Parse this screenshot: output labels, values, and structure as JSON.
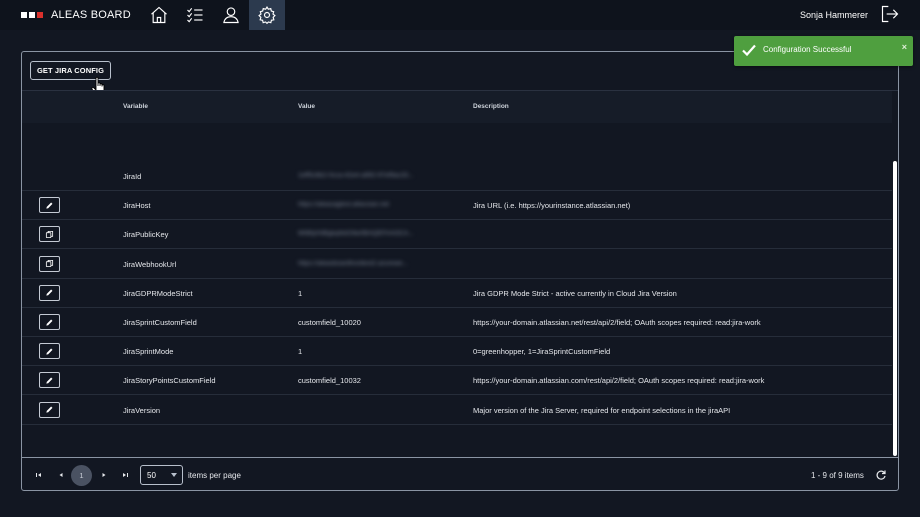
{
  "app": {
    "brand": "ALEAS BOARD",
    "logo_colors": [
      "#ffffff",
      "#ffffff",
      "#d9302c"
    ],
    "nav": [
      {
        "icon": "home-icon"
      },
      {
        "icon": "checklist-icon"
      },
      {
        "icon": "user-icon"
      },
      {
        "icon": "gear-icon",
        "active": true
      }
    ],
    "user_name": "Sonja Hammerer"
  },
  "toolbar": {
    "get_config_label": "GET JIRA CONFIG"
  },
  "table": {
    "headers": {
      "variable": "Variable",
      "value": "Value",
      "description": "Description"
    },
    "rows": [
      {
        "action": "",
        "variable": "JiraId",
        "value": "1eff5c6b2-0cca-42e4-a992-97ef9ac33...",
        "value_redacted": true,
        "description": ""
      },
      {
        "action": "edit",
        "variable": "JiraHost",
        "value": "https://aleasagtest.atlassian.net",
        "value_redacted": true,
        "description": "Jira URL (i.e. https://yourinstance.atlassian.net)"
      },
      {
        "action": "copy",
        "variable": "JiraPublicKey",
        "value": "MIIBIjANBgkqhkiG9w0BAQEFAAOCA...",
        "value_redacted": true,
        "description": ""
      },
      {
        "action": "copy",
        "variable": "JiraWebhookUrl",
        "value": "https://aleasboardhosttest2.azurewe...",
        "value_redacted": true,
        "description": ""
      },
      {
        "action": "edit",
        "variable": "JiraGDPRModeStrict",
        "value": "1",
        "value_redacted": false,
        "description": "Jira GDPR Mode Strict - active currently in Cloud Jira Version"
      },
      {
        "action": "edit",
        "variable": "JiraSprintCustomField",
        "value": "customfield_10020",
        "value_redacted": false,
        "description": "https://your-domain.atlassian.net/rest/api/2/field; OAuth scopes required: read:jira-work"
      },
      {
        "action": "edit",
        "variable": "JiraSprintMode",
        "value": "1",
        "value_redacted": false,
        "description": "0=greenhopper, 1=JiraSprintCustomField"
      },
      {
        "action": "edit",
        "variable": "JiraStoryPointsCustomField",
        "value": "customfield_10032",
        "value_redacted": false,
        "description": "https://your-domain.atlassian.com/rest/api/2/field; OAuth scopes required: read:jira-work"
      },
      {
        "action": "edit",
        "variable": "JiraVersion",
        "value": "",
        "value_redacted": false,
        "description": "Major version of the Jira Server, required for endpoint selections in the jiraAPI"
      }
    ]
  },
  "pager": {
    "current_page": "1",
    "page_size": "50",
    "items_label": "items per page",
    "count_label": "1 - 9 of 9 items"
  },
  "toast": {
    "message": "Configuration Successful",
    "close": "×",
    "color": "#4f9f3f"
  }
}
